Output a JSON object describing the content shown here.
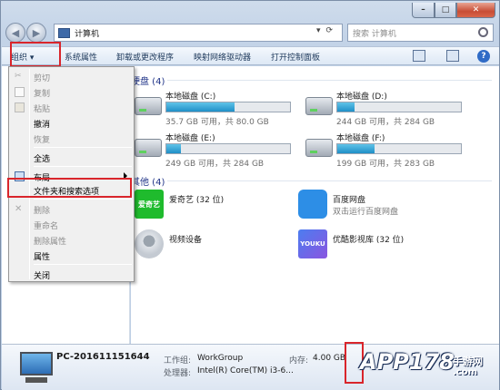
{
  "window": {
    "address": "计算机",
    "search_placeholder": "搜索 计算机",
    "controls": {
      "minimize": "–",
      "maximize": "□",
      "close": "✕"
    }
  },
  "toolbar": {
    "organize": "组织 ▾",
    "system_properties": "系统属性",
    "uninstall": "卸载或更改程序",
    "map_drive": "映射网络驱动器",
    "control_panel": "打开控制面板"
  },
  "content": {
    "hard_disks_header": "硬盘 (4)",
    "other_header": "其他 (4)",
    "drives": [
      {
        "name": "本地磁盘 (C:)",
        "info": "35.7 GB 可用，共 80.0 GB",
        "used_fraction": 0.55
      },
      {
        "name": "本地磁盘 (D:)",
        "info": "244 GB 可用，共 284 GB",
        "used_fraction": 0.14
      },
      {
        "name": "本地磁盘 (E:)",
        "info": "249 GB 可用，共 284 GB",
        "used_fraction": 0.12
      },
      {
        "name": "本地磁盘 (F:)",
        "info": "199 GB 可用，共 283 GB",
        "used_fraction": 0.3
      }
    ],
    "others": [
      {
        "label": "爱奇艺 (32 位)",
        "sub": ""
      },
      {
        "label": "百度网盘",
        "sub": "双击运行百度网盘"
      },
      {
        "label": "视频设备",
        "sub": ""
      },
      {
        "label": "优酷影视库 (32 位)",
        "sub": ""
      }
    ],
    "iqiyi_logo": "爱奇艺",
    "youku_logo": "YOUKU"
  },
  "menu": {
    "items": [
      {
        "label": "剪切",
        "enabled": false,
        "icon": "scissors-icon"
      },
      {
        "label": "复制",
        "enabled": false,
        "icon": "copy-icon"
      },
      {
        "label": "粘贴",
        "enabled": false,
        "icon": "paste-icon"
      },
      {
        "label": "撤消",
        "enabled": true,
        "icon": ""
      },
      {
        "label": "恢复",
        "enabled": false,
        "icon": ""
      },
      {
        "label": "全选",
        "enabled": true,
        "icon": ""
      },
      {
        "label": "布局",
        "enabled": true,
        "icon": "layout-icon"
      },
      {
        "label": "文件夹和搜索选项",
        "enabled": true,
        "icon": ""
      },
      {
        "label": "删除",
        "enabled": false,
        "icon": "delete-icon"
      },
      {
        "label": "重命名",
        "enabled": false,
        "icon": ""
      },
      {
        "label": "删除属性",
        "enabled": false,
        "icon": ""
      },
      {
        "label": "属性",
        "enabled": true,
        "icon": ""
      },
      {
        "label": "关闭",
        "enabled": true,
        "icon": ""
      }
    ]
  },
  "details": {
    "pc_name": "PC-201611151644",
    "workgroup_label": "工作组:",
    "workgroup": "WorkGroup",
    "memory_label": "内存:",
    "memory": "4.00 GB",
    "processor_label": "处理器:",
    "processor": "Intel(R) Core(TM) i3-6..."
  },
  "watermark": {
    "brand": "APP178",
    "tag": "手游网",
    "domain": ".com"
  },
  "colors": {
    "highlight_red": "#d9252b",
    "link_blue": "#1e3287",
    "drive_fill": "#1f8fc7"
  }
}
